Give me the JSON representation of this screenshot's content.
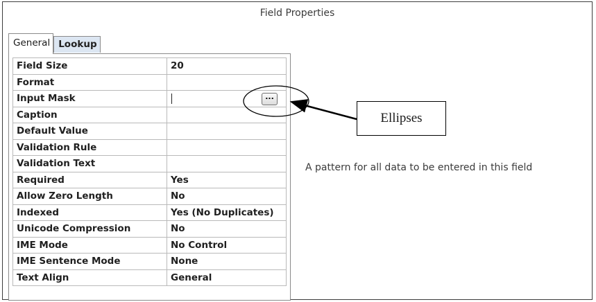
{
  "panel": {
    "title": "Field Properties"
  },
  "tabs": [
    {
      "label": "General",
      "active": true
    },
    {
      "label": "Lookup",
      "active": false
    }
  ],
  "properties": [
    {
      "name": "Field Size",
      "value": "20"
    },
    {
      "name": "Format",
      "value": ""
    },
    {
      "name": "Input Mask",
      "value": ""
    },
    {
      "name": "Caption",
      "value": ""
    },
    {
      "name": "Default Value",
      "value": ""
    },
    {
      "name": "Validation Rule",
      "value": ""
    },
    {
      "name": "Validation Text",
      "value": ""
    },
    {
      "name": "Required",
      "value": "Yes"
    },
    {
      "name": "Allow Zero Length",
      "value": "No"
    },
    {
      "name": "Indexed",
      "value": "Yes (No Duplicates)"
    },
    {
      "name": "Unicode Compression",
      "value": "No"
    },
    {
      "name": "IME Mode",
      "value": "No Control"
    },
    {
      "name": "IME Sentence Mode",
      "value": "None"
    },
    {
      "name": "Text Align",
      "value": "General"
    }
  ],
  "builder_button": {
    "label": "...",
    "icon": "ellipsis-icon"
  },
  "annotation": {
    "callout_label": "Ellipses"
  },
  "help": {
    "text": "A pattern for all data to be entered in this field"
  }
}
